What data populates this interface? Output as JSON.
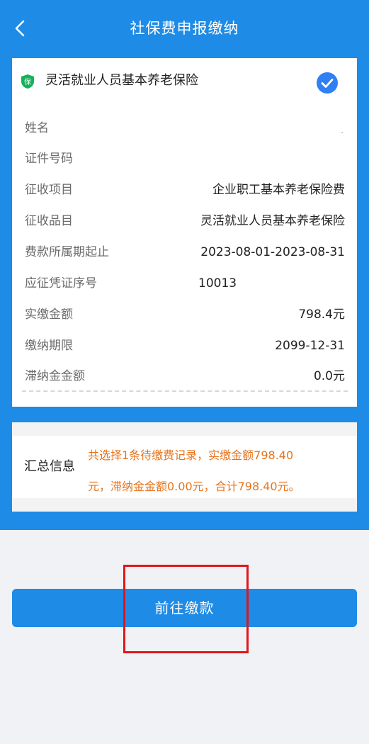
{
  "header": {
    "title": "社保费申报缴纳",
    "back_icon": "chevron-left-icon"
  },
  "insurance": {
    "badge_char": "保",
    "badge_color": "#15b25a",
    "name": "灵活就业人员基本养老保险",
    "check_color": "#2f7ff5",
    "selected": true
  },
  "details": [
    {
      "label": "姓名",
      "value": ""
    },
    {
      "label": "证件号码",
      "value": ""
    },
    {
      "label": "征收项目",
      "value": "企业职工基本养老保险费"
    },
    {
      "label": "征收品目",
      "value": "灵活就业人员基本养老保险"
    },
    {
      "label": "费款所属期起止",
      "value": "2023-08-01-2023-08-31"
    },
    {
      "label": "应征凭证序号",
      "value": "10013"
    },
    {
      "label": "实缴金额",
      "value": "798.4元"
    },
    {
      "label": "缴纳期限",
      "value": "2099-12-31"
    },
    {
      "label": "滞纳金金额",
      "value": "0.0元"
    }
  ],
  "summary": {
    "label": "汇总信息",
    "line1": "共选择1条待缴费记录，实缴金额798.40",
    "line2": "元，滞纳金金额0.00元，合计798.40元。"
  },
  "pay_button": {
    "label": "前往缴款"
  },
  "colors": {
    "primary": "#1e8be6",
    "summary_text": "#e8731b",
    "highlight": "#e0161b"
  }
}
